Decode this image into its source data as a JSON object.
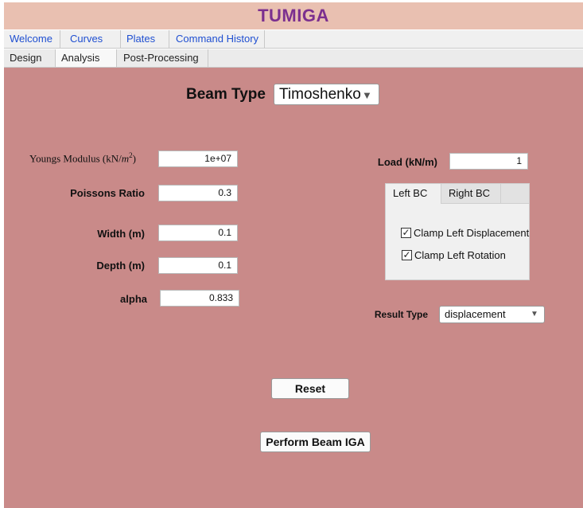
{
  "app": {
    "title": "TUMIGA"
  },
  "main_tabs": [
    {
      "label": "Welcome"
    },
    {
      "label": "Curves"
    },
    {
      "label": "Plates"
    },
    {
      "label": "Command History"
    }
  ],
  "sub_tabs": [
    {
      "label": "Design"
    },
    {
      "label": "Analysis"
    },
    {
      "label": "Post-Processing"
    }
  ],
  "beam_type": {
    "label": "Beam Type",
    "value": "Timoshenko",
    "arrow": "▼"
  },
  "params": {
    "youngs_label": "Youngs Modulus (kN/",
    "youngs_unit_m": "m",
    "youngs_exp": "2",
    "youngs_close": ")",
    "youngs_value": "1e+07",
    "poissons_label": "Poissons Ratio",
    "poissons_value": "0.3",
    "width_label": "Width (m)",
    "width_value": "0.1",
    "depth_label": "Depth (m)",
    "depth_value": "0.1",
    "alpha_label": "alpha",
    "alpha_value": "0.833"
  },
  "load": {
    "label": "Load (kN/m)",
    "value": "1"
  },
  "bc": {
    "tabs": [
      {
        "label": "Left BC"
      },
      {
        "label": "Right BC"
      }
    ],
    "clamp_displacement": {
      "label": "Clamp Left Displacement",
      "checked": true,
      "mark": "✓"
    },
    "clamp_rotation": {
      "label": "Clamp Left Rotation",
      "checked": true,
      "mark": "✓"
    }
  },
  "result": {
    "label": "Result Type",
    "value": "displacement",
    "arrow": "▼"
  },
  "buttons": {
    "reset": "Reset",
    "perform": "Perform Beam IGA"
  },
  "colors": {
    "panel": "#c98a89",
    "title_bg": "#e9c0b1",
    "title_text": "#7b2f8f",
    "tab_text": "#1f4fd1"
  }
}
